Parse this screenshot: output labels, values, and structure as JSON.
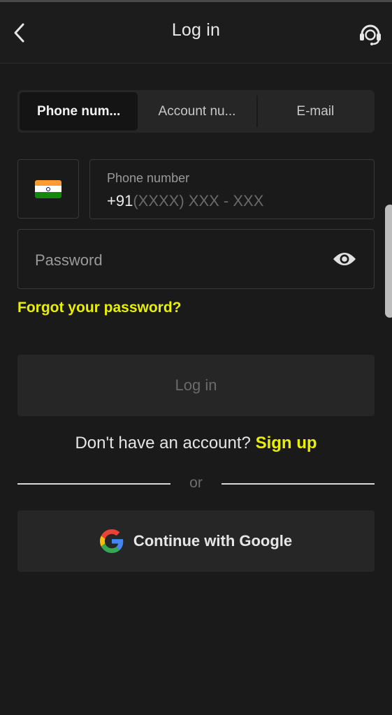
{
  "header": {
    "title": "Log in",
    "back_icon": "chevron-left-icon",
    "support_icon": "headset-support-icon"
  },
  "tabs": [
    {
      "label": "Phone num...",
      "active": true
    },
    {
      "label": "Account nu...",
      "active": false
    },
    {
      "label": "E-mail",
      "active": false
    }
  ],
  "country": {
    "flag_icon": "india-flag-icon"
  },
  "phone": {
    "label": "Phone number",
    "code": "+91",
    "placeholder": "(XXXX) XXX - XXX"
  },
  "password": {
    "placeholder": "Password",
    "toggle_icon": "eye-icon"
  },
  "forgot_label": "Forgot your password?",
  "login_label": "Log in",
  "signup": {
    "prompt": "Don't have an account?",
    "link": "Sign up"
  },
  "divider_text": "or",
  "google": {
    "label": "Continue with Google",
    "icon": "google-icon"
  },
  "colors": {
    "background": "#1a1a1a",
    "accent": "#e8f000",
    "surface": "#262626",
    "border": "#3a3a3a"
  }
}
